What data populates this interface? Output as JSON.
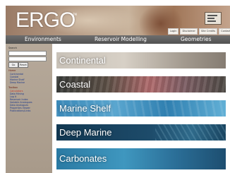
{
  "header": {
    "logo": "ERGO",
    "logo_mark": "TM",
    "top_buttons": [
      "Login",
      "Disclaimer",
      "Site Credits",
      "Contact"
    ]
  },
  "nav": {
    "items": [
      "Environments",
      "Reservoir Modelling",
      "Geometries"
    ]
  },
  "sidebar": {
    "search_label": "Search",
    "buttons": [
      "Go",
      "Reset"
    ],
    "nav_heading": "Home",
    "links": [
      "Continental",
      "Coastal",
      "Marine Shelf",
      "Deep Marine"
    ],
    "tools_heading": "Toolbox",
    "tools": [
      "Calculators",
      "Data Mining",
      "Log It",
      "Reservoir Index",
      "Variable Analogues",
      "Data Analogues",
      "Properties Viewer",
      "Publications/Links"
    ]
  },
  "main": {
    "banners": [
      "Continental",
      "Coastal",
      "Marine Shelf",
      "Deep Marine",
      "Carbonates"
    ]
  },
  "colors": {
    "nav_bg": "#5e5e5e",
    "sidebar_bg": "#b0a393",
    "deep_marine": "#1d4b6a",
    "marine_shelf": "#4a98c4"
  }
}
